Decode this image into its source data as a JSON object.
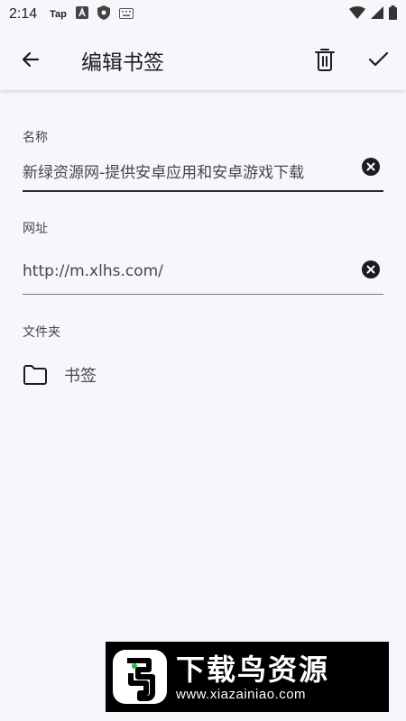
{
  "status_bar": {
    "time": "2:14",
    "app_label": "Tap"
  },
  "toolbar": {
    "title": "编辑书签",
    "back_icon": "arrow-back-icon",
    "delete_icon": "trash-icon",
    "save_icon": "checkmark-icon"
  },
  "form": {
    "name": {
      "label": "名称",
      "value": "新绿资源网-提供安卓应用和安卓游戏下载"
    },
    "url": {
      "label": "网址",
      "value": "http://m.xlhs.com/"
    },
    "folder": {
      "label": "文件夹",
      "value": "书签",
      "icon": "folder-icon"
    }
  },
  "watermark": {
    "title": "下载鸟资源",
    "url": "www.xiazainiao.com"
  },
  "colors": {
    "background": "#f7f6fb",
    "text_primary": "#1c1b1f",
    "text_secondary": "#49454f",
    "underline_focused": "#2b2838"
  }
}
